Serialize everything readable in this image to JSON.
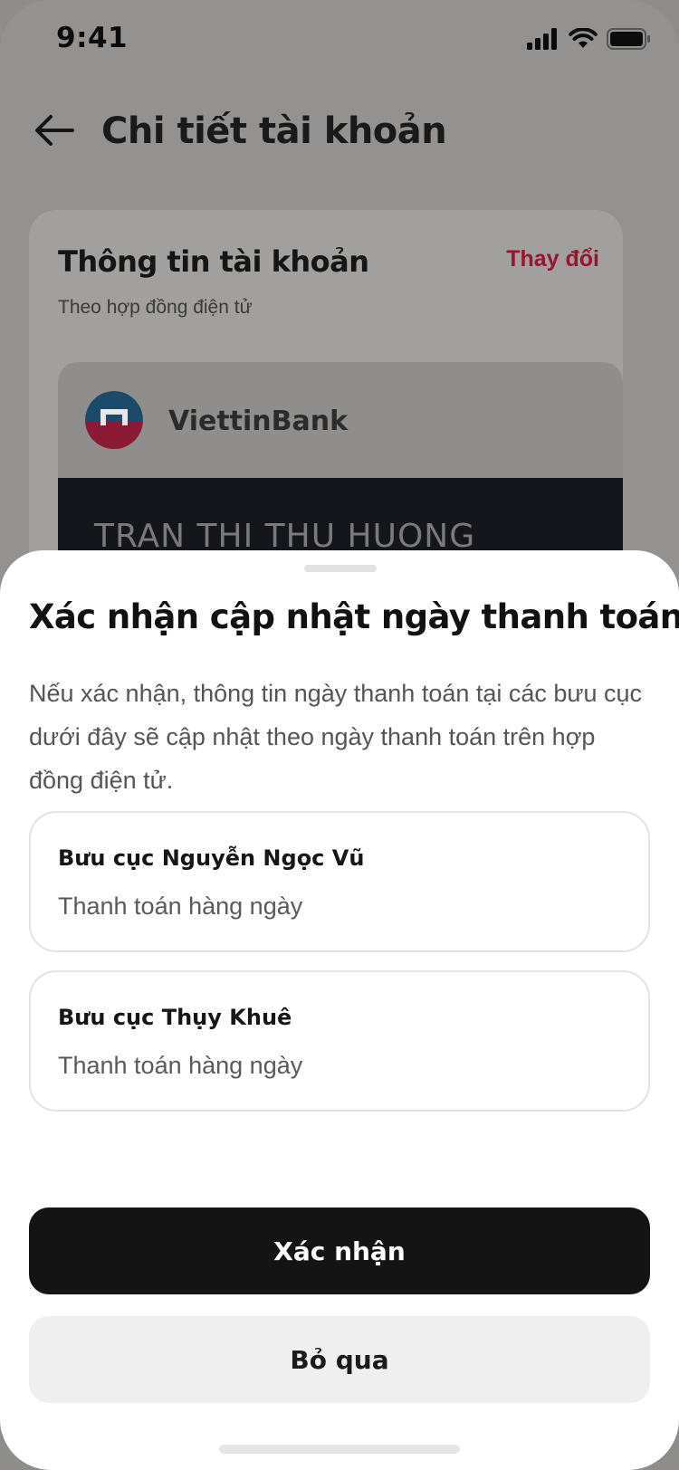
{
  "status_bar": {
    "time": "9:41",
    "icons": [
      "cellular-signal-icon",
      "wifi-icon",
      "battery-icon"
    ]
  },
  "header": {
    "back_icon": "arrow-left-icon",
    "title": "Chi tiết tài khoản"
  },
  "account_card": {
    "title": "Thông tin tài khoản",
    "subtitle": "Theo hợp đồng điện tử",
    "change_label": "Thay đổi",
    "bank_name": "ViettinBank",
    "holder_name": "TRAN THI THU HUONG"
  },
  "sheet": {
    "title": "Xác nhận cập nhật ngày thanh toán",
    "description": "Nếu xác nhận, thông tin ngày thanh toán tại các bưu cục dưới đây sẽ cập nhật theo ngày thanh toán trên hợp đồng điện tử.",
    "offices": [
      {
        "name": "Bưu cục Nguyễn Ngọc Vũ",
        "payment": "Thanh toán hàng ngày"
      },
      {
        "name": "Bưu cục Thụy Khuê",
        "payment": "Thanh toán hàng ngày"
      }
    ],
    "confirm_label": "Xác nhận",
    "skip_label": "Bỏ qua"
  },
  "colors": {
    "accent_red": "#9c1230",
    "primary_button": "#141414",
    "secondary_button": "#efefef"
  }
}
